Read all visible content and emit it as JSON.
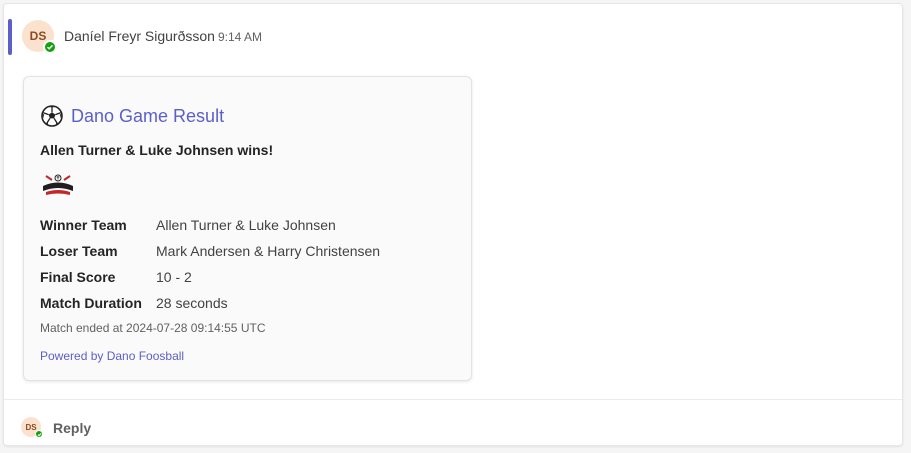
{
  "message": {
    "sender": {
      "name": "Daníel Freyr Sigurðsson",
      "initials": "DS",
      "presence": "available"
    },
    "time": "9:14 AM",
    "accent_color": "#5b5fc7"
  },
  "card": {
    "icon": "soccer-ball-icon",
    "title": "Dano Game Result",
    "headline": "Allen Turner & Luke Johnsen wins!",
    "logo": "dano-logo",
    "facts": [
      {
        "key": "Winner Team",
        "value": "Allen Turner & Luke Johnsen"
      },
      {
        "key": "Loser Team",
        "value": "Mark Andersen & Harry Christensen"
      },
      {
        "key": "Final Score",
        "value": "10 - 2"
      },
      {
        "key": "Match Duration",
        "value": "28 seconds"
      }
    ],
    "ended": "Match ended at 2024-07-28 09:14:55 UTC",
    "powered_by": "Powered by Dano Foosball"
  },
  "reply": {
    "avatar_initials": "DS",
    "label": "Reply"
  }
}
